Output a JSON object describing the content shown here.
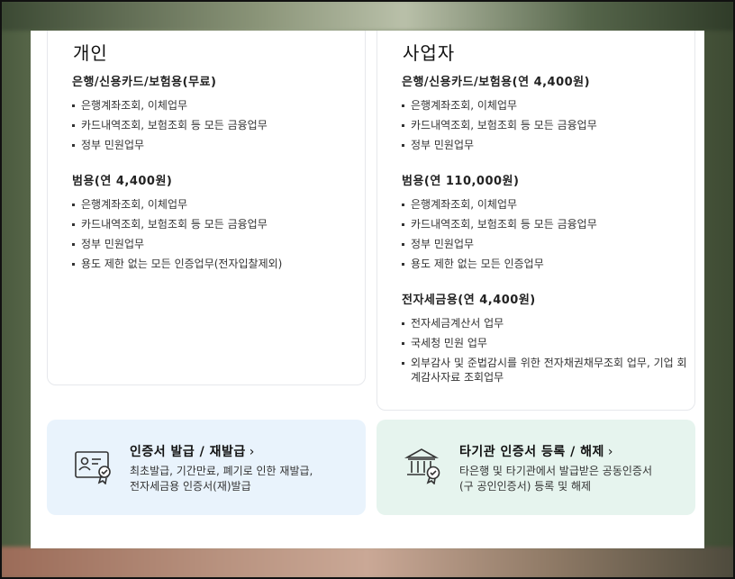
{
  "personal": {
    "heading": "개인",
    "sections": [
      {
        "title": "은행/신용카드/보험용(무료)",
        "items": [
          "은행계좌조회, 이체업무",
          "카드내역조회, 보험조회 등 모든 금융업무",
          "정부 민원업무"
        ]
      },
      {
        "title": "범용(연 4,400원)",
        "items": [
          "은행계좌조회, 이체업무",
          "카드내역조회, 보험조회 등 모든 금융업무",
          "정부 민원업무",
          "용도 제한 없는 모든 인증업무(전자입찰제외)"
        ]
      }
    ]
  },
  "business": {
    "heading": "사업자",
    "sections": [
      {
        "title": "은행/신용카드/보험용(연 4,400원)",
        "items": [
          "은행계좌조회, 이체업무",
          "카드내역조회, 보험조회 등 모든 금융업무",
          "정부 민원업무"
        ]
      },
      {
        "title": "범용(연 110,000원)",
        "items": [
          "은행계좌조회, 이체업무",
          "카드내역조회, 보험조회 등 모든 금융업무",
          "정부 민원업무",
          "용도 제한 없는 모든 인증업무"
        ]
      },
      {
        "title": "전자세금용(연 4,400원)",
        "items": [
          "전자세금계산서 업무",
          "국세청 민원 업무",
          "외부감사 및 준법감시를 위한 전자채권채무조회 업무, 기업 회계감사자료 조회업무"
        ]
      }
    ]
  },
  "banners": {
    "issue": {
      "title": "인증서 발급 / 재발급",
      "chevron": "›",
      "desc_line1": "최초발급, 기간만료, 폐기로 인한 재발급,",
      "desc_line2": "전자세금용 인증서(재)발급",
      "icon": "certificate-card-icon"
    },
    "register": {
      "title": "타기관 인증서 등록 / 해제",
      "chevron": "›",
      "desc_line1": "타은행 및 타기관에서 발급받은 공동인증서",
      "desc_line2": "(구 공인인증서) 등록 및 해제",
      "icon": "bank-certificate-icon"
    }
  },
  "colors": {
    "banner_blue": "#e9f3fc",
    "banner_green": "#e6f4ee",
    "card_border": "#e6e8ec"
  }
}
